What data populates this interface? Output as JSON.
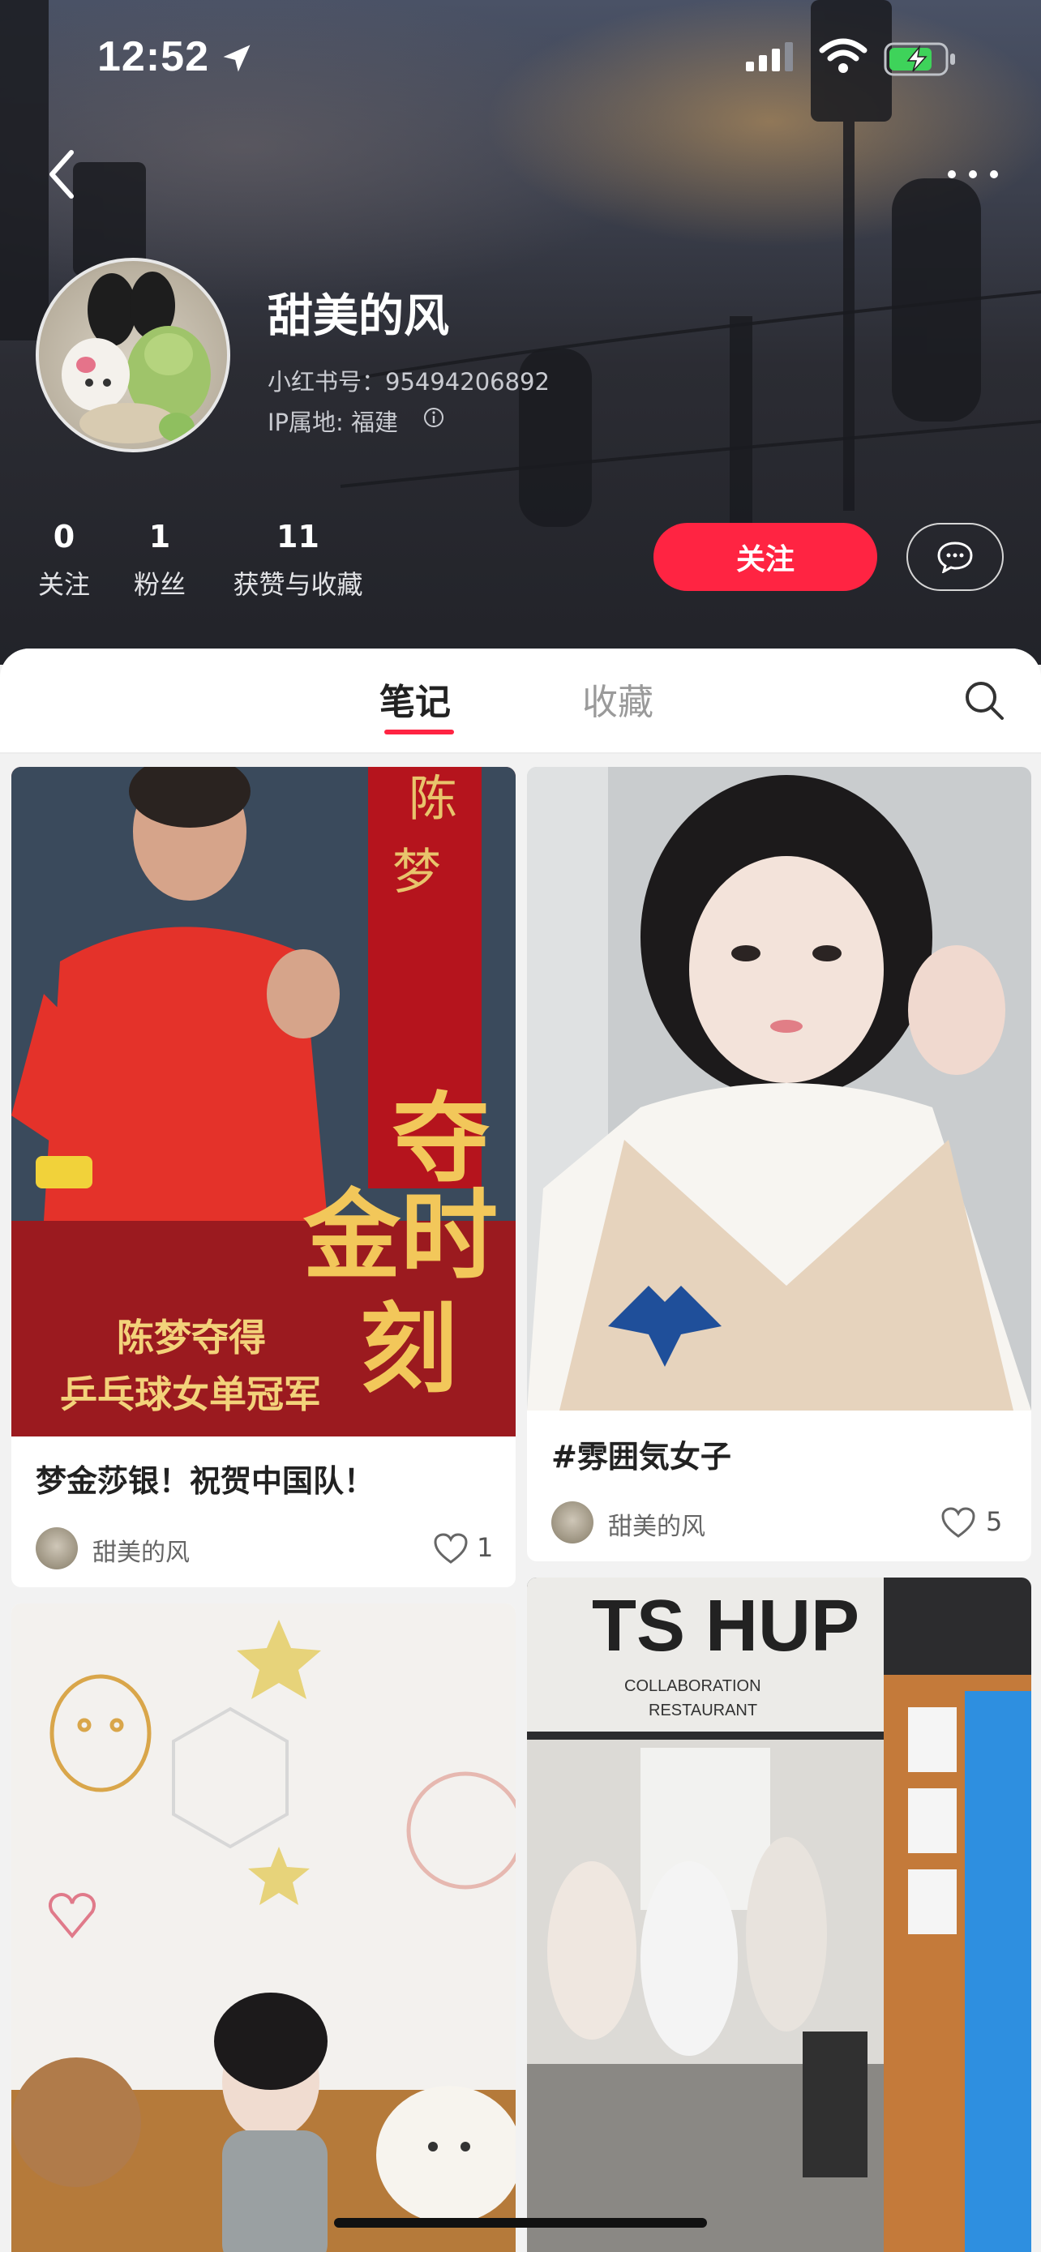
{
  "status_bar": {
    "time": "12:52"
  },
  "profile": {
    "name": "甜美的风",
    "id_line": "小红书号：95494206892",
    "ip_line": "IP属地: 福建",
    "stats": [
      {
        "value": "0",
        "label": "关注"
      },
      {
        "value": "1",
        "label": "粉丝"
      },
      {
        "value": "11",
        "label": "获赞与收藏"
      }
    ],
    "follow_label": "关注"
  },
  "tabs": {
    "notes": "笔记",
    "favorites": "收藏"
  },
  "notes": [
    {
      "title": "梦金莎银！祝贺中国队！",
      "author": "甜美的风",
      "likes": "1",
      "image_texts": {
        "vertical_name": "陈梦",
        "headline": "夺金时刻",
        "line1": "陈梦夺得",
        "line2": "乒乓球女单冠军"
      }
    },
    {
      "title": "#雰囲気女子",
      "author": "甜美的风",
      "likes": "5"
    },
    {
      "title": "",
      "author": "",
      "likes": ""
    },
    {
      "title": "",
      "author": "",
      "likes": "",
      "image_texts": {
        "sign_big": "TS HUP",
        "sign_small_1": "COLLABORATION",
        "sign_small_2": "RESTAURANT"
      }
    }
  ],
  "colors": {
    "accent": "#ff2442"
  },
  "icons": [
    "location-arrow-icon",
    "signal-icon",
    "wifi-icon",
    "battery-charging-icon",
    "back-icon",
    "more-icon",
    "info-icon",
    "message-icon",
    "search-icon",
    "heart-icon"
  ]
}
